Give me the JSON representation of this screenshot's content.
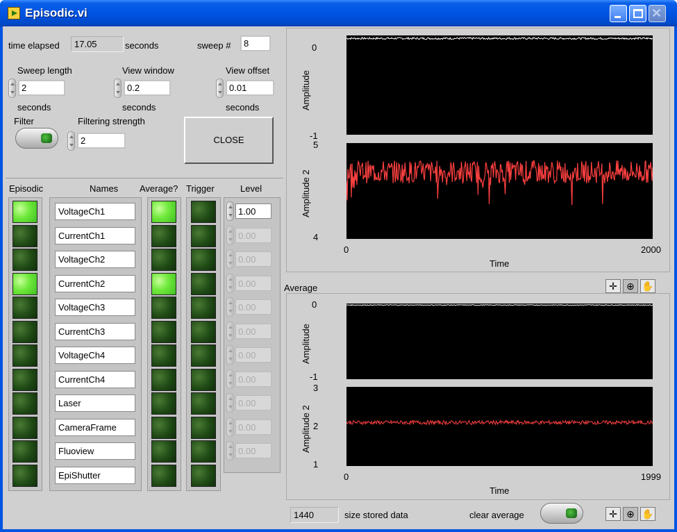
{
  "window": {
    "title": "Episodic.vi"
  },
  "top": {
    "time_elapsed_label": "time elapsed",
    "time_elapsed_value": "17.05",
    "time_elapsed_unit": "seconds",
    "sweep_label": "sweep #",
    "sweep_value": "8"
  },
  "sweep_length": {
    "label": "Sweep length",
    "value": "2",
    "unit": "seconds"
  },
  "view_window": {
    "label": "View window",
    "value": "0.2",
    "unit": "seconds"
  },
  "view_offset": {
    "label": "View offset",
    "value": "0.01",
    "unit": "seconds"
  },
  "filter": {
    "label": "Filter"
  },
  "filtering_strength": {
    "label": "Filtering strength",
    "value": "2"
  },
  "close_button": {
    "label": "CLOSE"
  },
  "table": {
    "headers": [
      "Episodic",
      "Names",
      "Average?",
      "Trigger",
      "Level"
    ],
    "rows": [
      {
        "episodic": true,
        "name": "VoltageCh1",
        "average": true,
        "trigger": false,
        "level": "1.00",
        "level_enabled": true
      },
      {
        "episodic": false,
        "name": "CurrentCh1",
        "average": false,
        "trigger": false,
        "level": "0.00",
        "level_enabled": false
      },
      {
        "episodic": false,
        "name": "VoltageCh2",
        "average": false,
        "trigger": false,
        "level": "0.00",
        "level_enabled": false
      },
      {
        "episodic": true,
        "name": "CurrentCh2",
        "average": true,
        "trigger": false,
        "level": "0.00",
        "level_enabled": false
      },
      {
        "episodic": false,
        "name": "VoltageCh3",
        "average": false,
        "trigger": false,
        "level": "0.00",
        "level_enabled": false
      },
      {
        "episodic": false,
        "name": "CurrentCh3",
        "average": false,
        "trigger": false,
        "level": "0.00",
        "level_enabled": false
      },
      {
        "episodic": false,
        "name": "VoltageCh4",
        "average": false,
        "trigger": false,
        "level": "0.00",
        "level_enabled": false
      },
      {
        "episodic": false,
        "name": "CurrentCh4",
        "average": false,
        "trigger": false,
        "level": "0.00",
        "level_enabled": false
      },
      {
        "episodic": false,
        "name": "Laser",
        "average": false,
        "trigger": false,
        "level": "0.00",
        "level_enabled": false
      },
      {
        "episodic": false,
        "name": "CameraFrame",
        "average": false,
        "trigger": false,
        "level": "0.00",
        "level_enabled": false
      },
      {
        "episodic": false,
        "name": "Fluoview",
        "average": false,
        "trigger": false,
        "level": "0.00",
        "level_enabled": false
      },
      {
        "episodic": false,
        "name": "EpiShutter",
        "average": false,
        "trigger": false,
        "level": null,
        "level_enabled": false
      }
    ]
  },
  "graph_top": {
    "plot1_ylabel": "Amplitude",
    "plot1_ticks": [
      "0",
      "-1"
    ],
    "plot2_ylabel": "Amplitude 2",
    "plot2_ticks": [
      "5",
      "4"
    ],
    "x_ticks": [
      "0",
      "2000"
    ],
    "xlabel": "Time"
  },
  "average_label": "Average",
  "graph_bottom": {
    "plot1_ylabel": "Amplitude",
    "plot1_ticks": [
      "0",
      "-1"
    ],
    "plot2_ylabel": "Amplitude 2",
    "plot2_ticks": [
      "3",
      "2",
      "1"
    ],
    "x_ticks": [
      "0",
      "1999"
    ],
    "xlabel": "Time"
  },
  "bottom": {
    "size_value": "1440",
    "size_label": "size stored data",
    "clear_average_label": "clear average"
  },
  "chart_data": [
    {
      "type": "line",
      "ylabel": "Amplitude",
      "xlabel": "Time",
      "xlim": [
        0,
        2000
      ],
      "ylim": [
        -1,
        0
      ],
      "series": [
        {
          "color": "#ffffff",
          "approx_level": -0.03,
          "noise": 0.01
        }
      ]
    },
    {
      "type": "line",
      "ylabel": "Amplitude 2",
      "xlabel": "Time",
      "xlim": [
        0,
        2000
      ],
      "ylim": [
        4,
        5
      ],
      "series": [
        {
          "color": "#ff4040",
          "approx_level": 4.7,
          "noise": 0.12
        }
      ]
    },
    {
      "type": "line",
      "ylabel": "Amplitude",
      "xlabel": "Time",
      "xlim": [
        0,
        1999
      ],
      "ylim": [
        -1,
        0
      ],
      "series": [
        {
          "color": "#ffffff",
          "approx_level": -0.02,
          "noise": 0.005
        }
      ]
    },
    {
      "type": "line",
      "ylabel": "Amplitude 2",
      "xlabel": "Time",
      "xlim": [
        0,
        1999
      ],
      "ylim": [
        1,
        3
      ],
      "series": [
        {
          "color": "#ff4040",
          "approx_level": 2.1,
          "noise": 0.05
        }
      ]
    }
  ]
}
